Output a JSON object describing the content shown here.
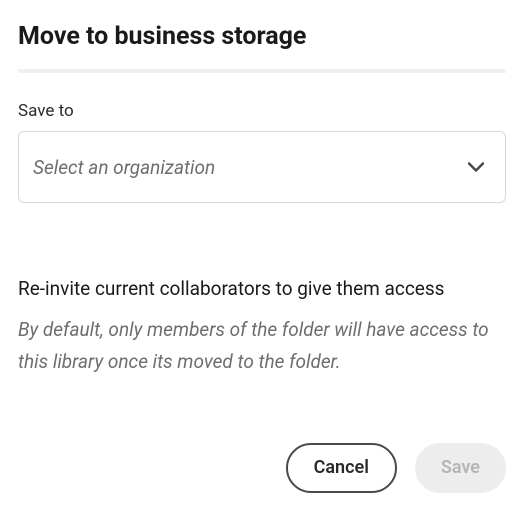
{
  "dialog": {
    "title": "Move to business storage"
  },
  "saveTo": {
    "label": "Save to",
    "placeholder": "Select an organization",
    "selected": ""
  },
  "reinvite": {
    "heading": "Re-invite current collaborators to give them access",
    "description": "By default, only members of the folder will have access to this library once its moved to the folder."
  },
  "buttons": {
    "cancel": "Cancel",
    "save": "Save"
  }
}
